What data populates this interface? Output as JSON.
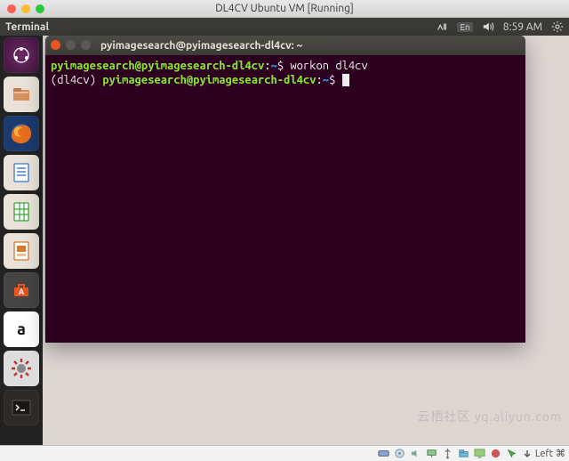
{
  "host_window": {
    "title": "DL4CV Ubuntu VM [Running]"
  },
  "unity_panel": {
    "app_title": "Terminal",
    "lang": "En",
    "clock": "8:59 AM"
  },
  "launcher": {
    "items": [
      {
        "name": "dash",
        "label": "Dash"
      },
      {
        "name": "files",
        "label": "Files"
      },
      {
        "name": "firefox",
        "label": "Firefox"
      },
      {
        "name": "writer",
        "label": "LibreOffice Writer"
      },
      {
        "name": "calc",
        "label": "LibreOffice Calc"
      },
      {
        "name": "impress",
        "label": "LibreOffice Impress"
      },
      {
        "name": "software",
        "label": "Ubuntu Software"
      },
      {
        "name": "amazon",
        "label": "Amazon"
      },
      {
        "name": "settings",
        "label": "System Settings"
      },
      {
        "name": "terminal",
        "label": "Terminal"
      }
    ]
  },
  "terminal": {
    "window_title": "pyimagesearch@pyimagesearch-dl4cv: ~",
    "prompt1_user": "pyimagesearch@pyimagesearch-dl4cv",
    "prompt1_sep": ":",
    "prompt1_path": "~",
    "prompt1_end": "$ ",
    "command1": "workon dl4cv",
    "venv": "(dl4cv) ",
    "prompt2_user": "pyimagesearch@pyimagesearch-dl4cv",
    "prompt2_sep": ":",
    "prompt2_path": "~",
    "prompt2_end": "$ "
  },
  "vb_status": {
    "hostkey_label": "Left",
    "hostkey_mod": "⌘"
  },
  "watermark": "云栖社区  yq.aliyun.com"
}
